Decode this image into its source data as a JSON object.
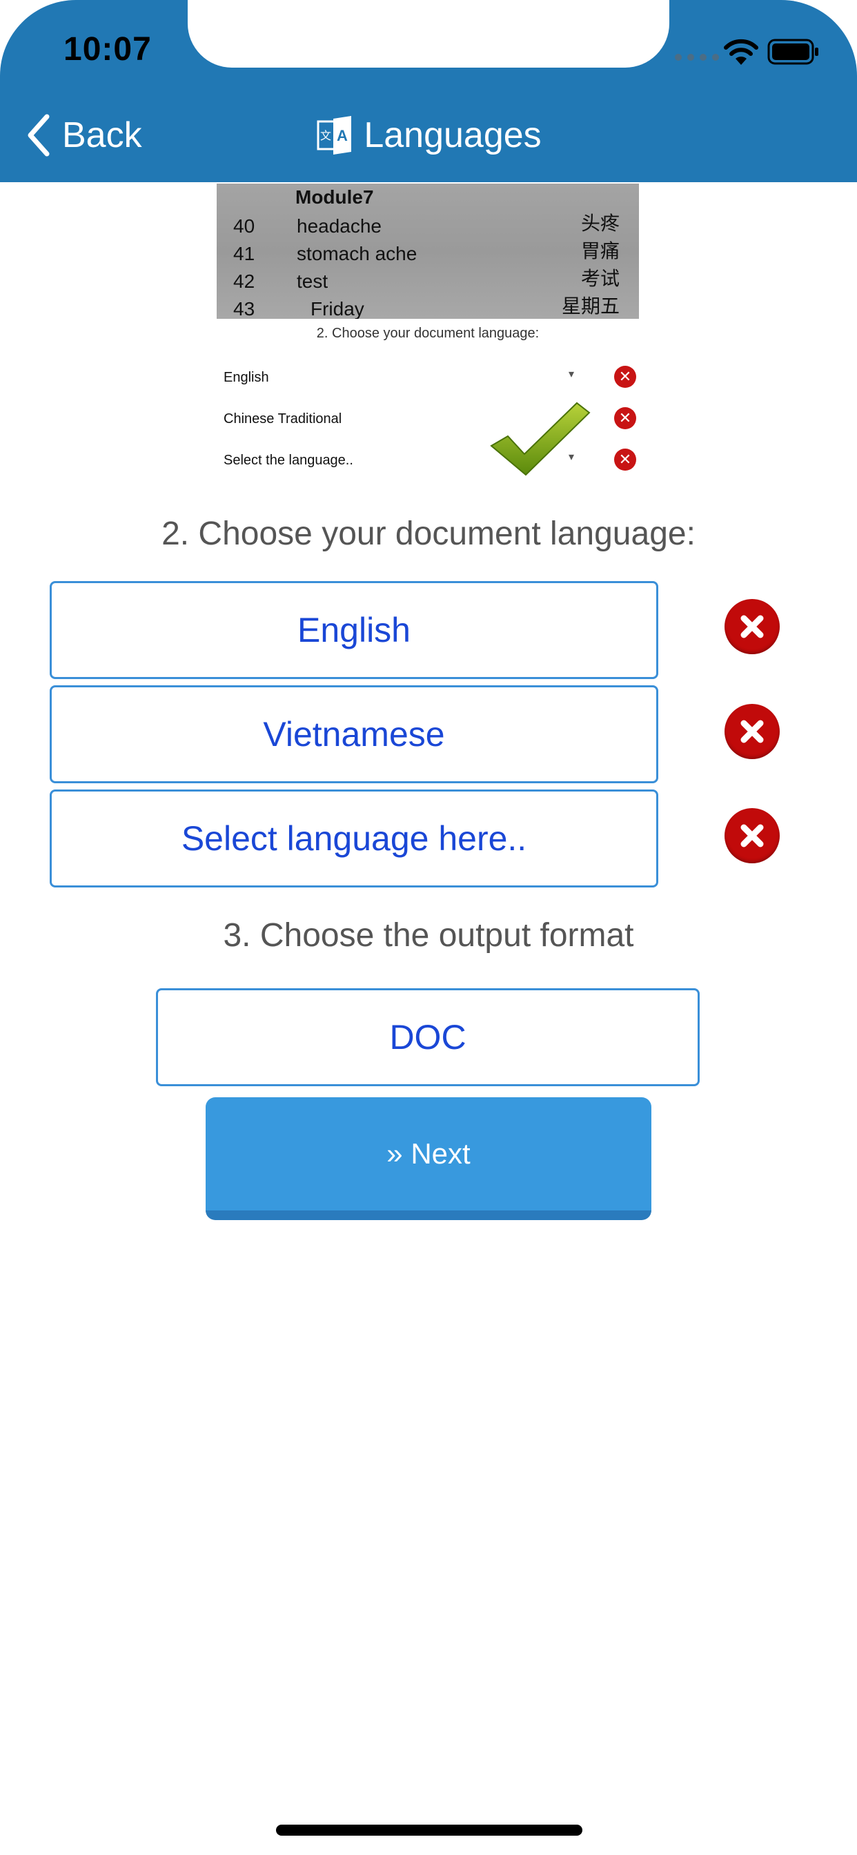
{
  "status_bar": {
    "time": "10:07"
  },
  "nav": {
    "back_label": "Back",
    "title": "Languages",
    "title_icon": "translate-icon"
  },
  "tutorial": {
    "photo_heading": "Module7",
    "photo_rows": [
      {
        "num": "40",
        "word": "headache",
        "chinese": "头疼"
      },
      {
        "num": "41",
        "word": "stomach ache",
        "chinese": "胃痛"
      },
      {
        "num": "42",
        "word": "test",
        "chinese": "考试"
      },
      {
        "num": "43",
        "word": "Friday",
        "chinese": "星期五"
      }
    ],
    "caption": "2. Choose your document language:",
    "rows": [
      {
        "label": "English",
        "arrow": "▾",
        "x": "✕"
      },
      {
        "label": "Chinese Traditional",
        "arrow": "",
        "x": "✕"
      },
      {
        "label": "Select the language..",
        "arrow": "▾",
        "x": "✕"
      }
    ]
  },
  "form": {
    "language_heading": "2. Choose your document language:",
    "languages": [
      "English",
      "Vietnamese",
      "Select language here.."
    ],
    "format_heading": "3. Choose the output format",
    "format_value": "DOC",
    "next_label": "» Next"
  },
  "colors": {
    "header": "#2178b4",
    "accent_text": "#1a47d6",
    "box_border": "#3a8fd8",
    "remove": "#c10a0a",
    "next_button": "#3899de"
  }
}
